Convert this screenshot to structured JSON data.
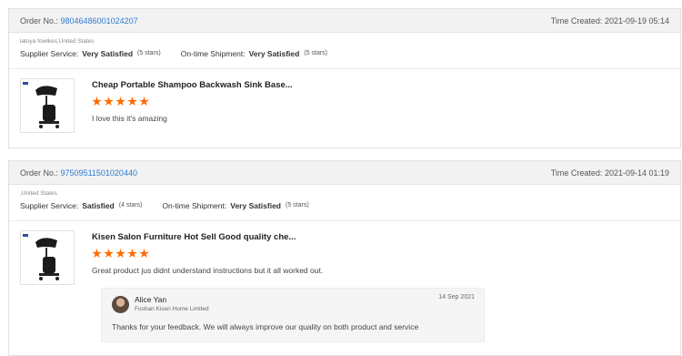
{
  "reviews": [
    {
      "order_label": "Order No.:",
      "order_no": "98046486001024207",
      "time_label": "Time Created:",
      "time": "2021-09-19 05:14",
      "buyer": "latoya fowlkes,United States",
      "supplier_label": "Supplier Service:",
      "supplier_value": "Very Satisfied",
      "supplier_stars": "(5 stars)",
      "shipment_label": "On-time Shipment:",
      "shipment_value": "Very Satisfied",
      "shipment_stars": "(5 stars)",
      "product_title": "Cheap Portable Shampoo Backwash Sink Base...",
      "rating": 5,
      "comment": "I love this it's amazing"
    },
    {
      "order_label": "Order No.:",
      "order_no": "97509511501020440",
      "time_label": "Time Created:",
      "time": "2021-09-14 01:19",
      "buyer": ",United States",
      "supplier_label": "Supplier Service:",
      "supplier_value": "Satisfied",
      "supplier_stars": "(4 stars)",
      "shipment_label": "On-time Shipment:",
      "shipment_value": "Very Satisfied",
      "shipment_stars": "(5 stars)",
      "product_title": "Kisen Salon Furniture Hot Sell Good quality che...",
      "rating": 5,
      "comment": "Great product jus didnt understand instructions but it all worked out.",
      "reply": {
        "name": "Alice Yan",
        "company": "Foshan Kisen Home Limited",
        "date": "14 Sep 2021",
        "text": "Thanks for your feedback. We will always improve our quality on both product and service"
      }
    }
  ],
  "colors": {
    "star": "#ff6a00",
    "link": "#2d7bd2",
    "header_bg": "#f2f2f2"
  },
  "icons": {
    "product_image": "shampoo-sink-chair-image",
    "avatar": "seller-avatar"
  }
}
